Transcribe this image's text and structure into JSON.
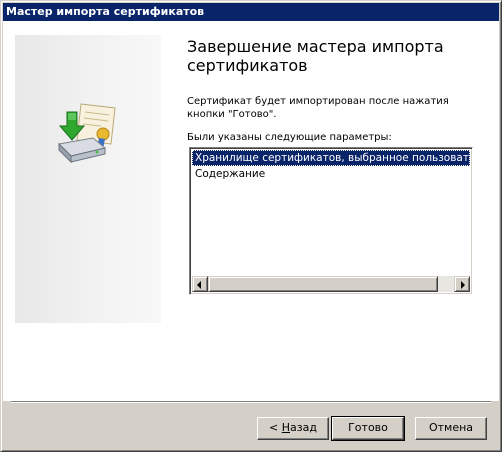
{
  "window": {
    "title": "Мастер импорта сертификатов"
  },
  "main": {
    "heading": "Завершение мастера импорта сертификатов",
    "description": "Сертификат будет импортирован после нажатия кнопки \"Готово\".",
    "params_label": "Были указаны следующие параметры:",
    "params": [
      "Хранилище сертификатов, выбранное пользователем",
      "Содержание"
    ],
    "selected_index": 0
  },
  "buttons": {
    "back_prefix": "< ",
    "back_accel": "Н",
    "back_rest": "азад",
    "finish": "Готово",
    "cancel": "Отмена"
  },
  "icons": {
    "wizard": "certificate-import-icon",
    "scroll_left": "arrow-left-icon",
    "scroll_right": "arrow-right-icon"
  },
  "colors": {
    "titlebar": "#0a246a",
    "selection": "#0a246a",
    "dialog_bg": "#d4d0c8"
  }
}
